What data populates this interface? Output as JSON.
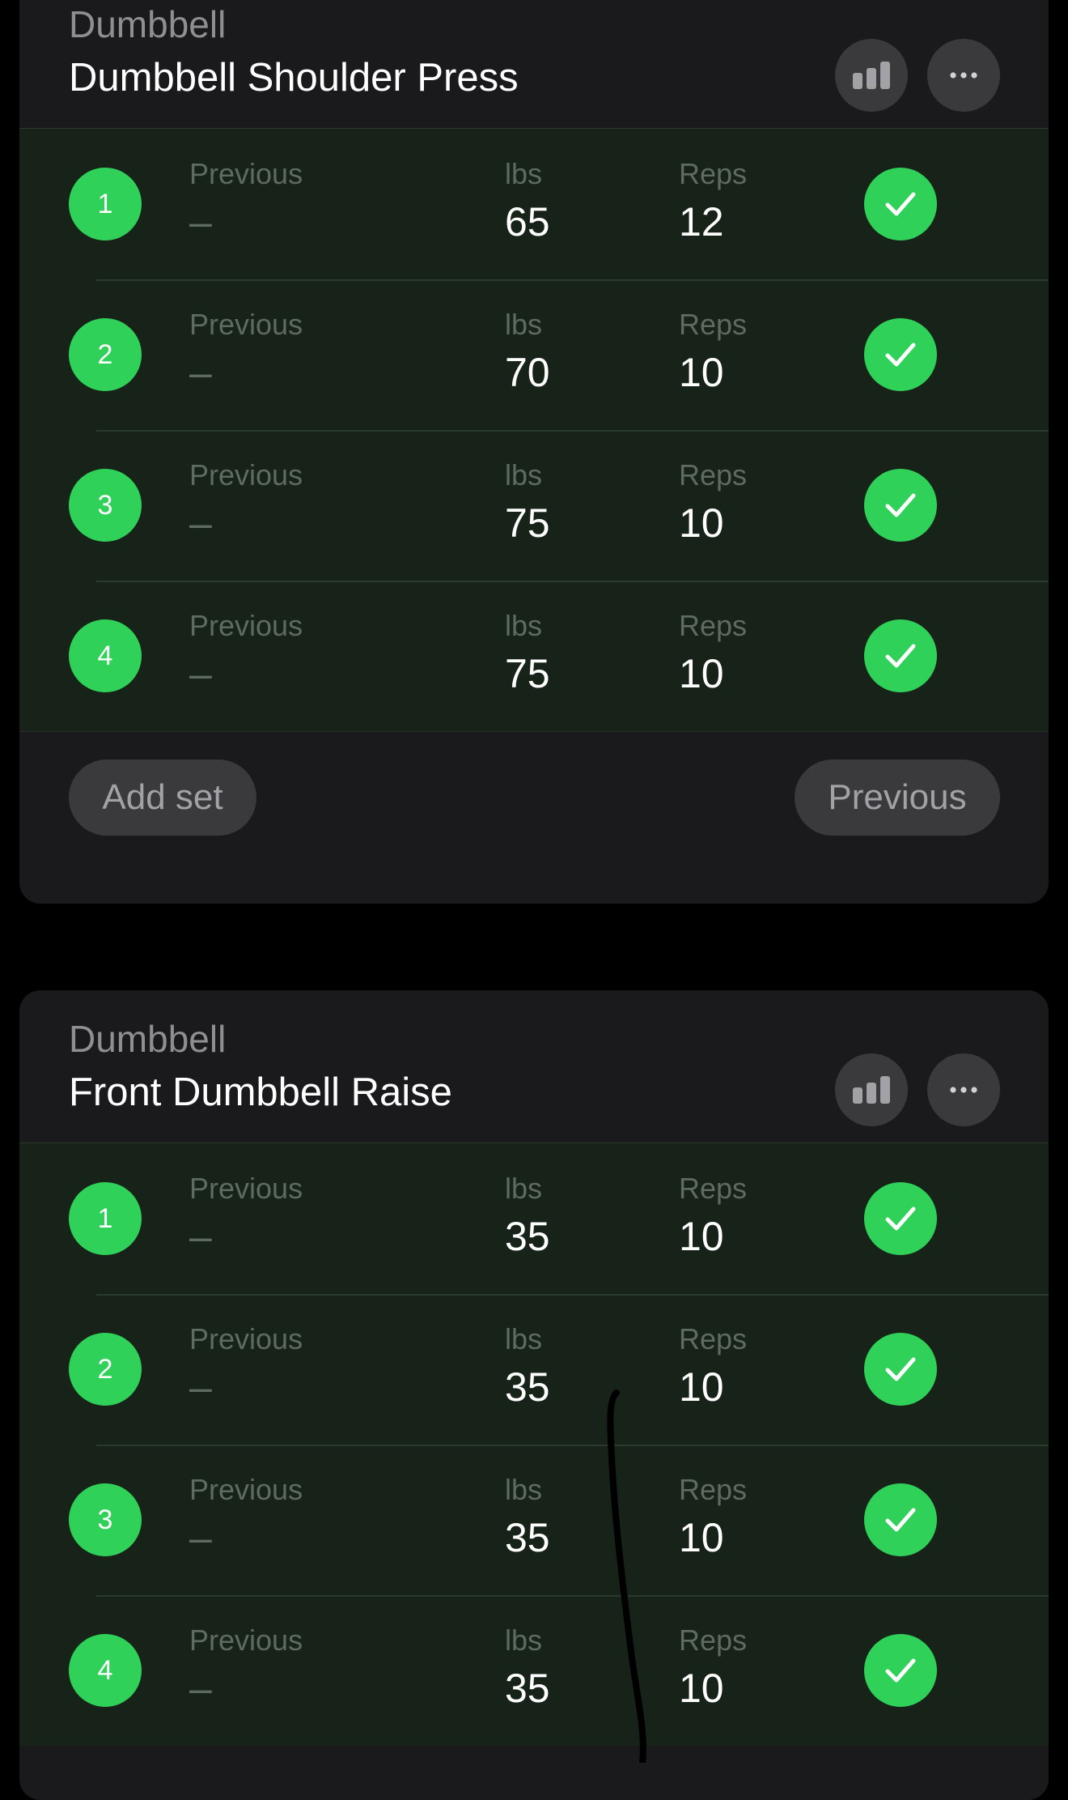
{
  "colors": {
    "background": "#000000",
    "card": "#1a1a1d",
    "completed_row": "#172219",
    "accent_green": "#30d158",
    "button_gray": "#3a3a3d"
  },
  "icons": {
    "stats": "bar-chart-icon",
    "more": "ellipsis-icon",
    "check": "checkmark-icon"
  },
  "exercises": [
    {
      "equipment": "Dumbbell",
      "name": "Dumbbell Shoulder Press",
      "column_labels": {
        "previous": "Previous",
        "weight": "lbs",
        "reps": "Reps"
      },
      "sets": [
        {
          "number": "1",
          "previous": "–",
          "weight": "65",
          "reps": "12",
          "completed": true
        },
        {
          "number": "2",
          "previous": "–",
          "weight": "70",
          "reps": "10",
          "completed": true
        },
        {
          "number": "3",
          "previous": "–",
          "weight": "75",
          "reps": "10",
          "completed": true
        },
        {
          "number": "4",
          "previous": "–",
          "weight": "75",
          "reps": "10",
          "completed": true
        }
      ],
      "add_set_label": "Add set",
      "previous_label": "Previous"
    },
    {
      "equipment": "Dumbbell",
      "name": "Front Dumbbell Raise",
      "column_labels": {
        "previous": "Previous",
        "weight": "lbs",
        "reps": "Reps"
      },
      "sets": [
        {
          "number": "1",
          "previous": "–",
          "weight": "35",
          "reps": "10",
          "completed": true
        },
        {
          "number": "2",
          "previous": "–",
          "weight": "35",
          "reps": "10",
          "completed": true
        },
        {
          "number": "3",
          "previous": "–",
          "weight": "35",
          "reps": "10",
          "completed": true
        },
        {
          "number": "4",
          "previous": "–",
          "weight": "35",
          "reps": "10",
          "completed": true
        }
      ]
    }
  ]
}
